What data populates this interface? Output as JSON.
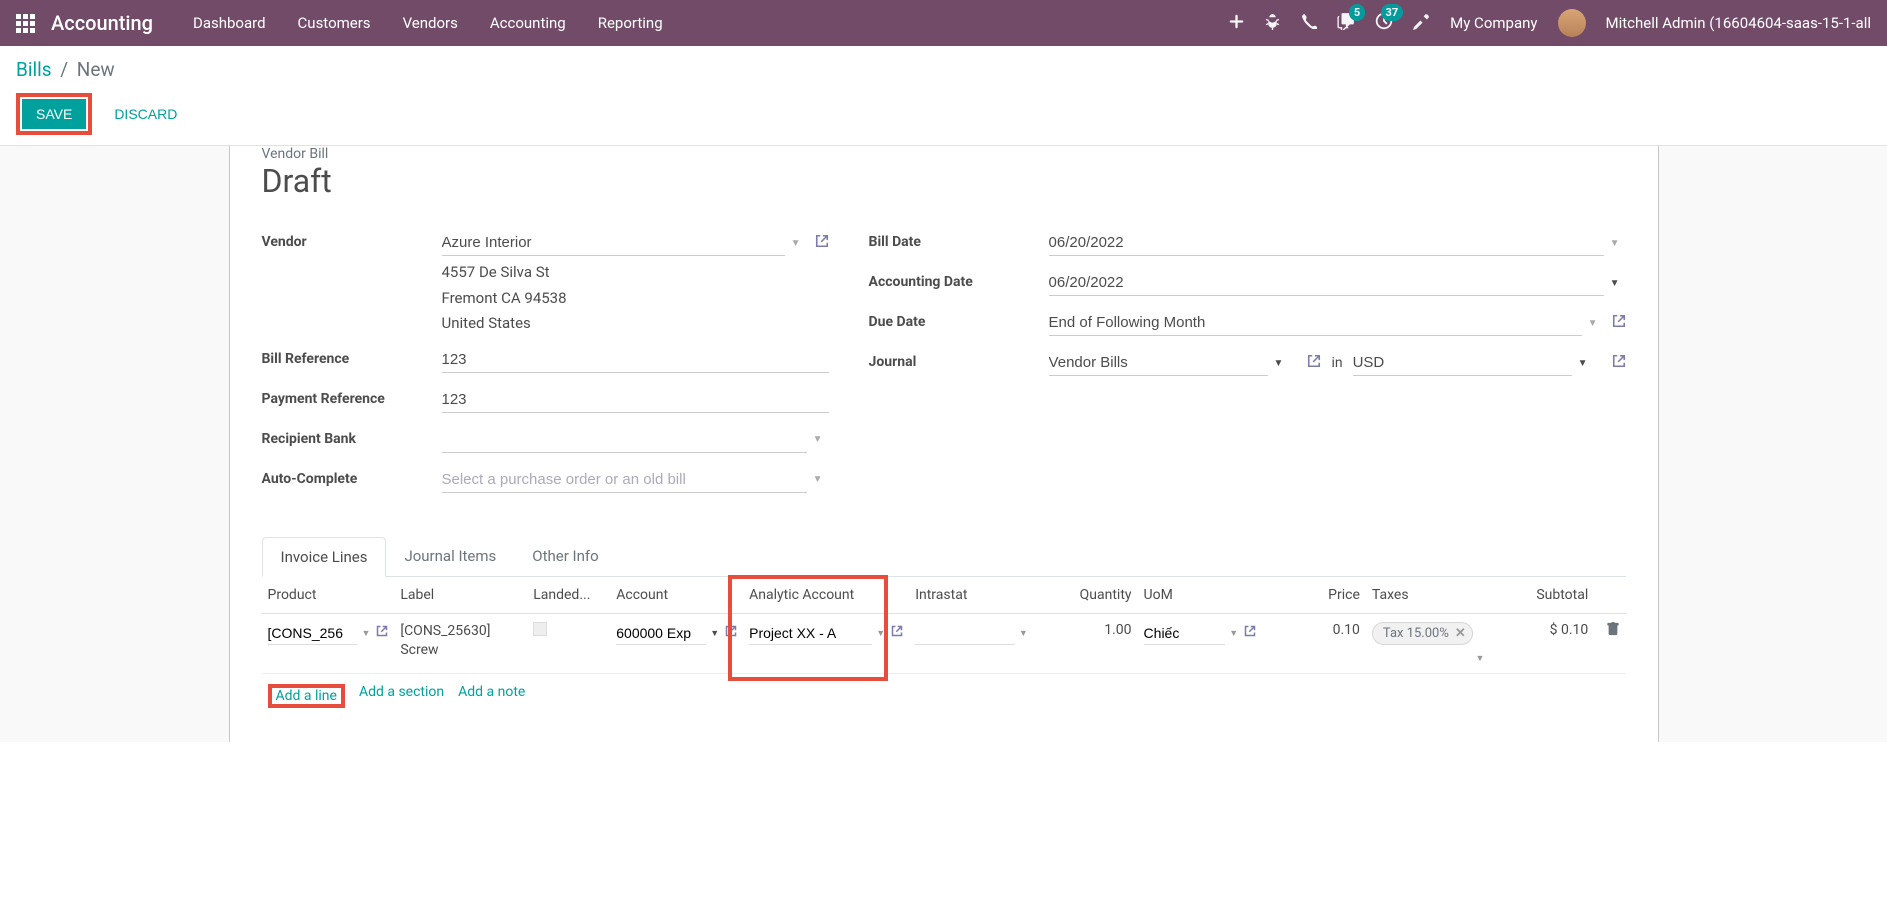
{
  "topnav": {
    "app_title": "Accounting",
    "menus": [
      "Dashboard",
      "Customers",
      "Vendors",
      "Accounting",
      "Reporting"
    ],
    "messages_badge": "5",
    "activities_badge": "37",
    "company": "My Company",
    "user": "Mitchell Admin (16604604-saas-15-1-all"
  },
  "breadcrumb": {
    "parent": "Bills",
    "current": "New"
  },
  "buttons": {
    "save": "SAVE",
    "discard": "DISCARD"
  },
  "form": {
    "type_label": "Vendor Bill",
    "status": "Draft",
    "labels": {
      "vendor": "Vendor",
      "bill_reference": "Bill Reference",
      "payment_reference": "Payment Reference",
      "recipient_bank": "Recipient Bank",
      "auto_complete": "Auto-Complete",
      "bill_date": "Bill Date",
      "accounting_date": "Accounting Date",
      "due_date": "Due Date",
      "journal": "Journal",
      "in": "in"
    },
    "values": {
      "vendor": "Azure Interior",
      "vendor_address_line1": "4557 De Silva St",
      "vendor_address_line2": "Fremont CA 94538",
      "vendor_address_line3": "United States",
      "bill_reference": "123",
      "payment_reference": "123",
      "recipient_bank": "",
      "auto_complete_placeholder": "Select a purchase order or an old bill",
      "bill_date": "06/20/2022",
      "accounting_date": "06/20/2022",
      "due_date": "End of Following Month",
      "journal": "Vendor Bills",
      "currency": "USD"
    }
  },
  "tabs": {
    "invoice_lines": "Invoice Lines",
    "journal_items": "Journal Items",
    "other_info": "Other Info"
  },
  "table": {
    "headers": {
      "product": "Product",
      "label": "Label",
      "landed": "Landed...",
      "account": "Account",
      "analytic": "Analytic Account",
      "intrastat": "Intrastat",
      "quantity": "Quantity",
      "uom": "UoM",
      "price": "Price",
      "taxes": "Taxes",
      "subtotal": "Subtotal"
    },
    "row": {
      "product": "[CONS_256",
      "label": "[CONS_25630] Screw",
      "account": "600000 Exp",
      "analytic": "Project XX - A",
      "quantity": "1.00",
      "uom": "Chiếc",
      "price": "0.10",
      "tax": "Tax 15.00%",
      "subtotal": "$ 0.10"
    },
    "actions": {
      "add_line": "Add a line",
      "add_section": "Add a section",
      "add_note": "Add a note"
    }
  }
}
